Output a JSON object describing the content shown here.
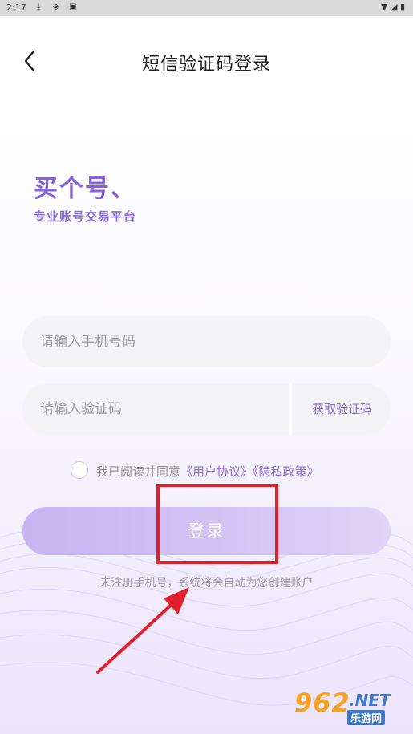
{
  "status_bar": {
    "time": "2:17"
  },
  "header": {
    "title": "短信验证码登录"
  },
  "slogan": {
    "line1": "买个号、",
    "line2": "专业账号交易平台"
  },
  "form": {
    "phone_placeholder": "请输入手机号码",
    "code_placeholder": "请输入验证码",
    "get_code_label": "获取验证码"
  },
  "agreement": {
    "text": "我已阅读并同意",
    "user_agreement": "《用户协议》",
    "privacy_policy": "《隐私政策》"
  },
  "login_button": "登录",
  "hint": "未注册手机号，系统将会自动为您创建账户",
  "watermark": {
    "number": "962",
    "suffix": ".NET",
    "cn": "乐游网"
  },
  "colors": {
    "accent": "#8660de",
    "annotation": "#e0202a",
    "button": "#cbb9f2"
  },
  "icons": [
    "back-icon",
    "download-icon",
    "shield-icon",
    "a-icon",
    "wifi-icon",
    "signal-icon",
    "battery-icon"
  ]
}
